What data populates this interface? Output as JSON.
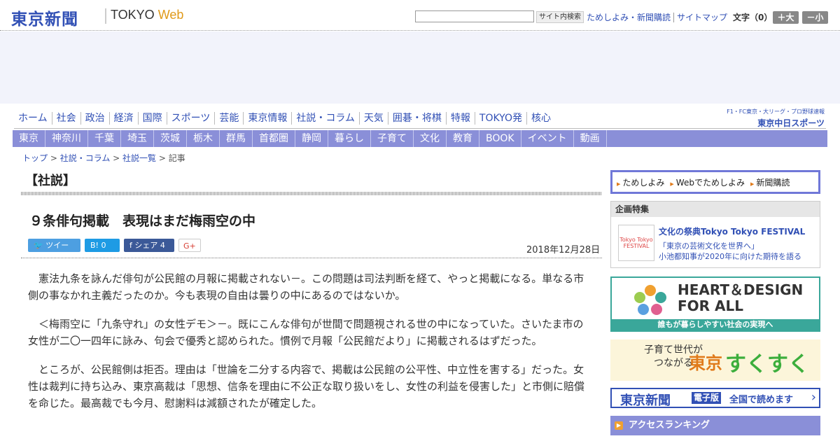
{
  "header": {
    "logo_jp": "東京新聞",
    "logo_en_main": "TOKYO ",
    "logo_en_accent": "Web",
    "search_placeholder": "",
    "search_button": "サイト内検索",
    "links": [
      "ためしよみ・新聞購読",
      "サイトマップ"
    ],
    "font_size_label": "文字（0）",
    "bigger_button": "＋大",
    "smaller_button": "－小"
  },
  "nav_main": [
    "ホーム",
    "社会",
    "政治",
    "経済",
    "国際",
    "スポーツ",
    "芸能",
    "東京情報",
    "社説・コラム",
    "天気",
    "囲碁・将棋",
    "特報",
    "TOKYO発",
    "核心"
  ],
  "sports_banner": {
    "line1": "F1・FC東京・大リーグ・プロ野球速報",
    "line2": "東京中日スポーツ"
  },
  "nav_sub": [
    "東京",
    "神奈川",
    "千葉",
    "埼玉",
    "茨城",
    "栃木",
    "群馬",
    "首都圏",
    "静岡",
    "暮らし",
    "子育て",
    "文化",
    "教育",
    "BOOK",
    "イベント",
    "動画"
  ],
  "breadcrumb": {
    "items": [
      "トップ",
      "社説・コラム",
      "社説一覧"
    ],
    "current": "記事",
    "sep": " > "
  },
  "article": {
    "section": "【社説】",
    "title": "９条俳句掲載　表現はまだ梅雨空の中",
    "share": {
      "tweet": "ツイート",
      "hatena": "B! 0",
      "facebook": "シェア 4",
      "gplus": "G+"
    },
    "date": "2018年12月28日",
    "paragraphs": [
      "憲法九条を詠んだ俳句が公民館の月報に掲載されない－。この問題は司法判断を経て、やっと掲載になる。単なる市側の事なかれ主義だったのか。今も表現の自由は曇りの中にあるのではないか。",
      "＜梅雨空に「九条守れ」の女性デモ＞－。既にこんな俳句が世間で問題視される世の中になっていた。さいたま市の女性が二〇一四年に詠み、句会で優秀と認められた。慣例で月報「公民館だより」に掲載されるはずだった。",
      "ところが、公民館側は拒否。理由は「世論を二分する内容で、掲載は公民館の公平性、中立性を害する」だった。女性は裁判に持ち込み、東京高裁は「思想、信条を理由に不公正な取り扱いをし、女性の利益を侵害した」と市側に賠償を命じた。最高裁でも今月、慰謝料は減額されたが確定した。"
    ]
  },
  "sidebar": {
    "top_links": [
      "ためしよみ",
      "Webでためしよみ",
      "新聞購読"
    ],
    "kikaku": {
      "heading": "企画特集",
      "thumb": "Tokyo Tokyo FESTIVAL",
      "title": "文化の祭典Tokyo Tokyo FESTIVAL",
      "desc1": "「東京の芸術文化を世界へ」",
      "desc2": "小池都知事が2020年に向けた期待を語る"
    },
    "heart": {
      "line1": "HEART＆DESIGN",
      "line2": "FOR ALL",
      "caption": "誰もが暮らしやすい社会の実現へ"
    },
    "sukusuku": {
      "line1": "子育て世代が",
      "line2": "つながる",
      "tokyo": "東京",
      "suku": "すくすく"
    },
    "denshi": {
      "logo": "東京新聞",
      "badge": "電子版",
      "text": "全国で読めます"
    },
    "ranking": "アクセスランキング"
  },
  "colors": {
    "brand": "#3150b5",
    "nav_bg": "#8a8fd8",
    "accent": "#e09a1a"
  }
}
